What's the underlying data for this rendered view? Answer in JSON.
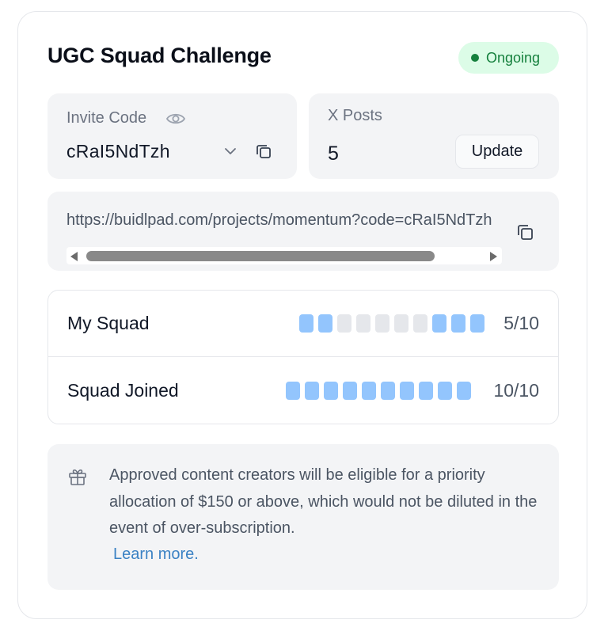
{
  "card": {
    "title": "UGC Squad Challenge",
    "status": {
      "label": "Ongoing",
      "color": "#15803d",
      "background": "#dcfce7"
    }
  },
  "invite": {
    "label": "Invite Code",
    "code": "cRaI5NdTzh",
    "icons": [
      "eye-icon",
      "chevron-down-icon",
      "copy-icon"
    ]
  },
  "posts": {
    "label": "X Posts",
    "count": "5",
    "update_label": "Update"
  },
  "referral": {
    "url": "https://buidlpad.com/projects/momentum?code=cRaI5NdTzh",
    "icons": [
      "copy-icon"
    ],
    "scroll_fraction": 0.0
  },
  "squads": [
    {
      "label": "My Squad",
      "count": "5/10",
      "segments": [
        true,
        true,
        false,
        false,
        false,
        false,
        false,
        true,
        true,
        true
      ]
    },
    {
      "label": "Squad Joined",
      "count": "10/10",
      "segments": [
        true,
        true,
        true,
        true,
        true,
        true,
        true,
        true,
        true,
        true
      ]
    }
  ],
  "info": {
    "text": "Approved content creators will be eligible for a priority allocation of $150 or above, which would not be diluted in the event of over-subscription.",
    "link_label": "Learn more.",
    "icon": "gift-icon",
    "link_color": "#3b82c4"
  },
  "colors": {
    "segment_on": "#93c5fd",
    "segment_off": "#e5e7eb",
    "panel_bg": "#f3f4f6"
  }
}
